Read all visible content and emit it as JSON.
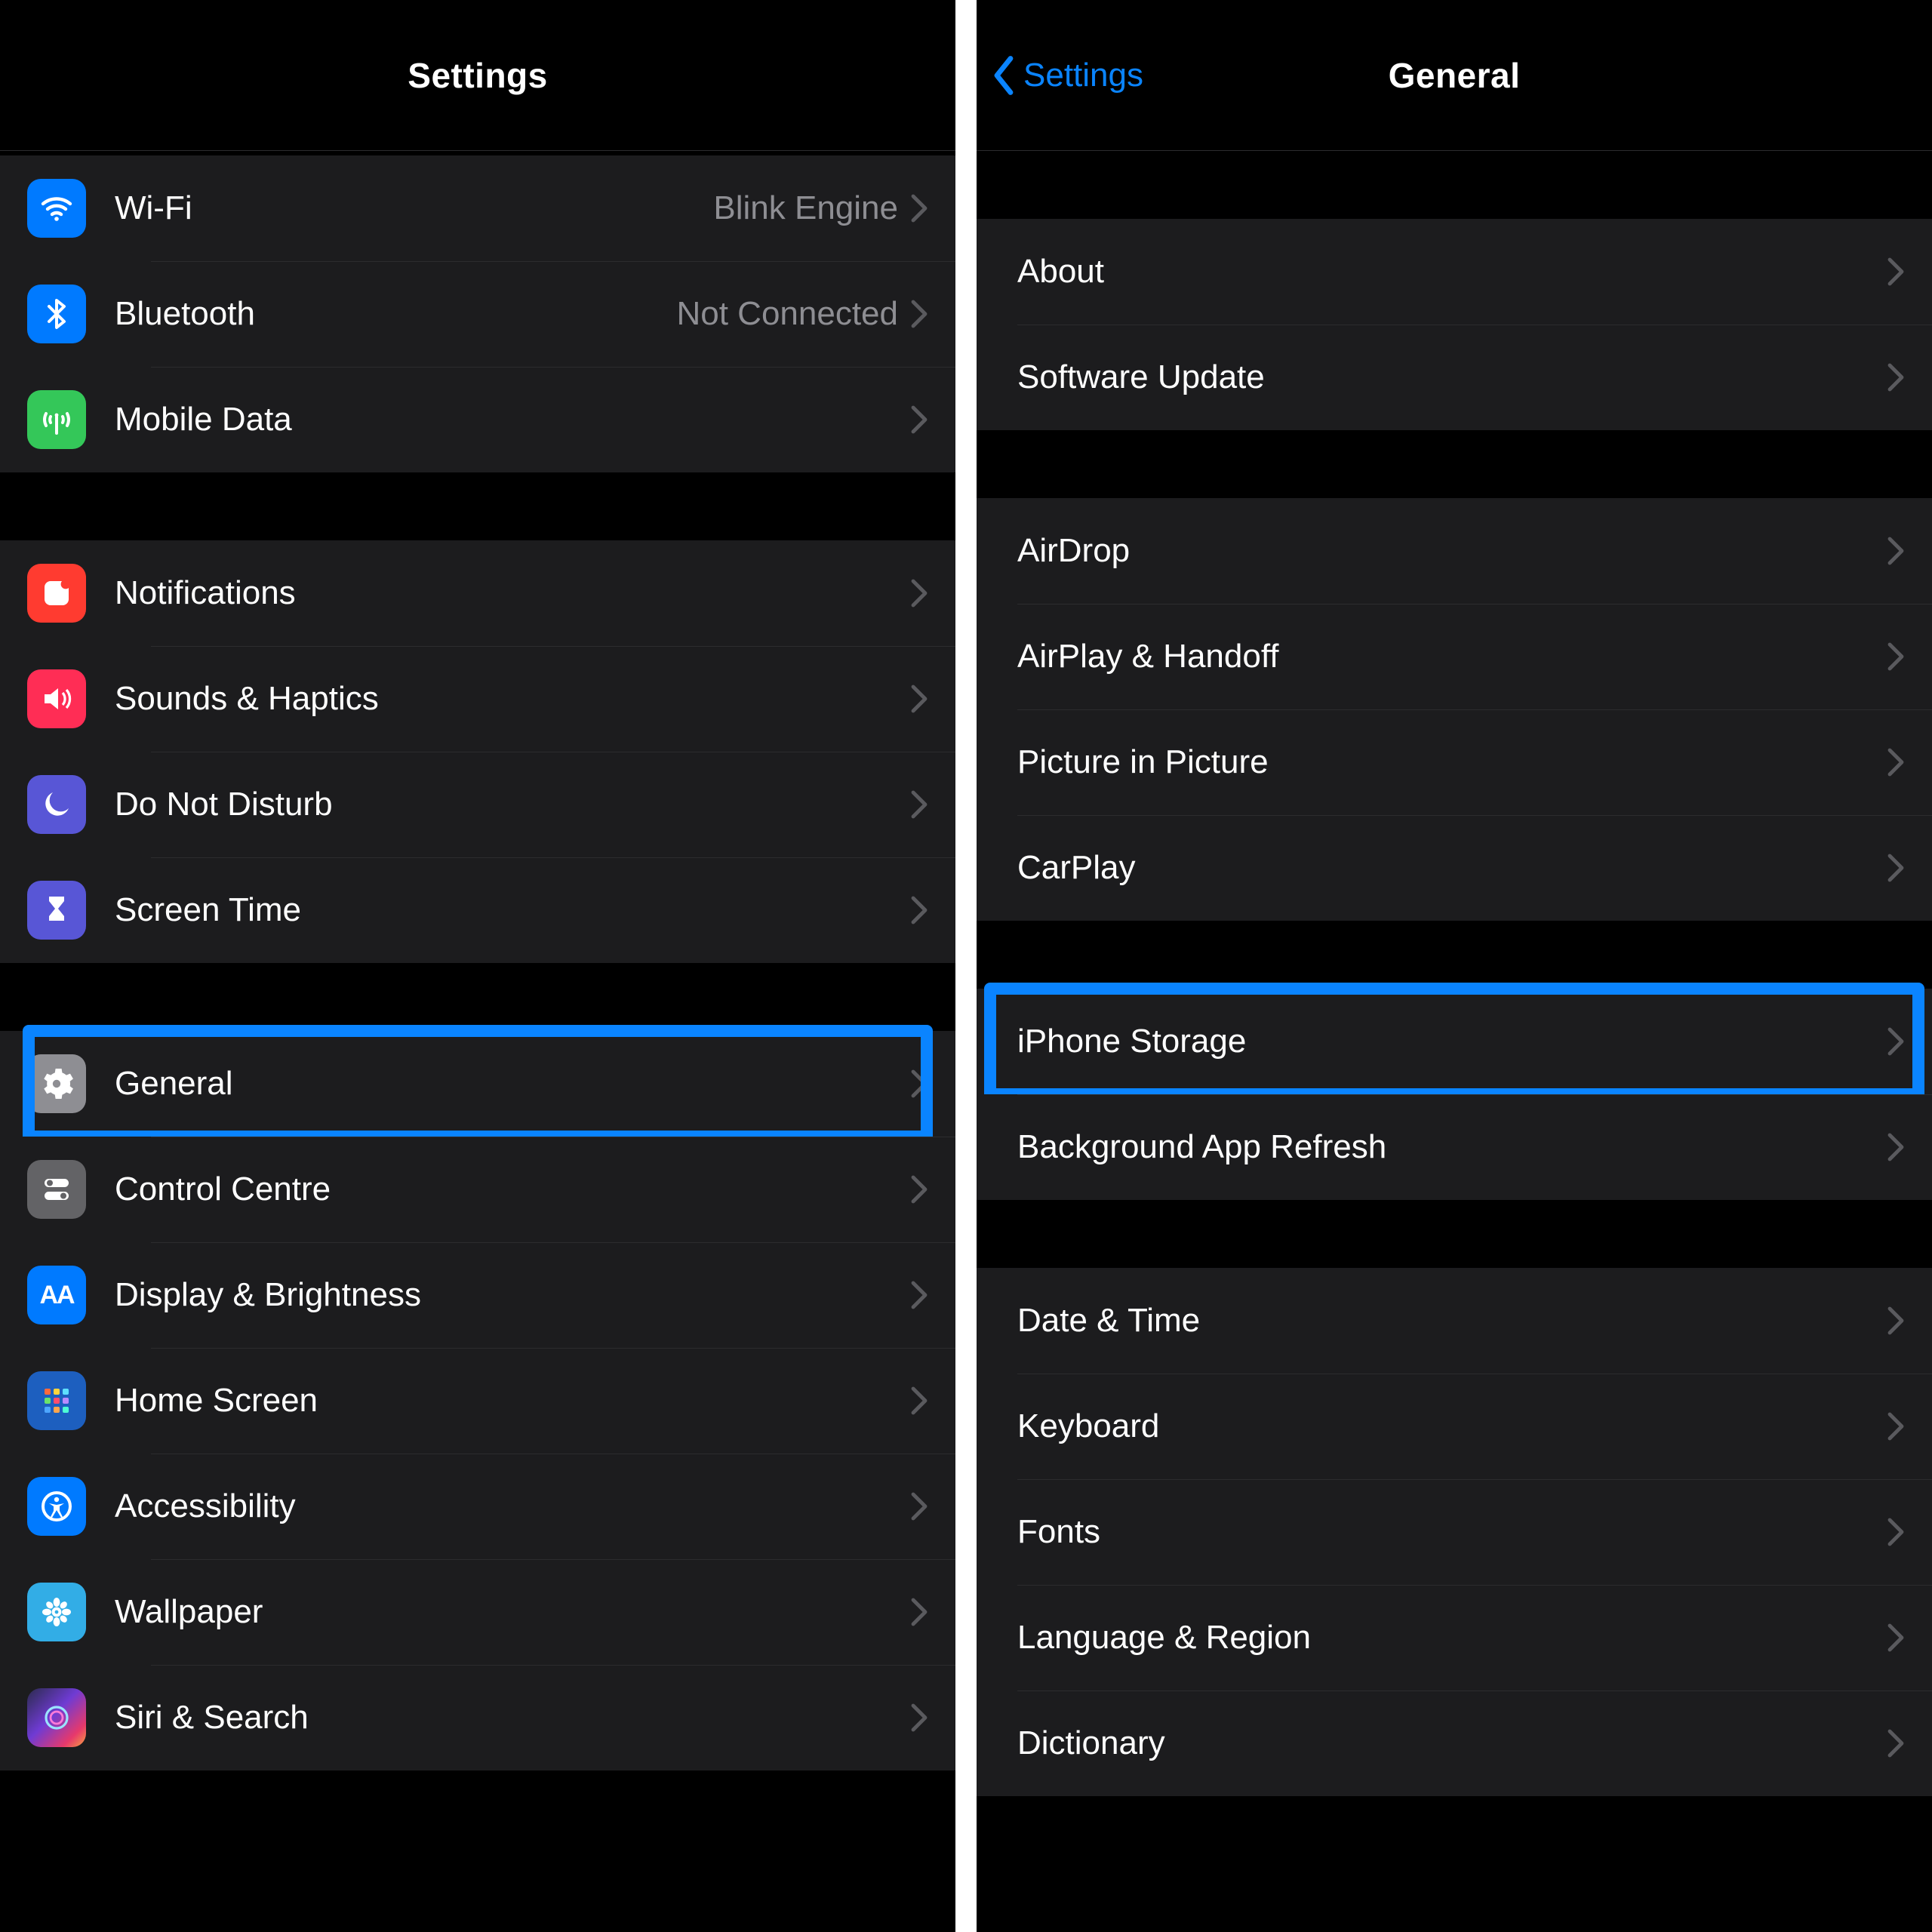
{
  "left": {
    "title": "Settings",
    "groups": [
      {
        "rows": [
          {
            "id": "wifi",
            "label": "Wi-Fi",
            "value": "Blink Engine",
            "icon": "wifi-icon",
            "icon_bg": "bg-blue"
          },
          {
            "id": "bluetooth",
            "label": "Bluetooth",
            "value": "Not Connected",
            "icon": "bluetooth-icon",
            "icon_bg": "bg-blue"
          },
          {
            "id": "mobile-data",
            "label": "Mobile Data",
            "value": "",
            "icon": "antenna-icon",
            "icon_bg": "bg-green"
          }
        ]
      },
      {
        "rows": [
          {
            "id": "notifications",
            "label": "Notifications",
            "value": "",
            "icon": "bell-square-icon",
            "icon_bg": "bg-red"
          },
          {
            "id": "sounds-haptics",
            "label": "Sounds & Haptics",
            "value": "",
            "icon": "speaker-icon",
            "icon_bg": "bg-pink"
          },
          {
            "id": "do-not-disturb",
            "label": "Do Not Disturb",
            "value": "",
            "icon": "moon-icon",
            "icon_bg": "bg-purple"
          },
          {
            "id": "screen-time",
            "label": "Screen Time",
            "value": "",
            "icon": "hourglass-icon",
            "icon_bg": "bg-purple"
          }
        ]
      },
      {
        "rows": [
          {
            "id": "general",
            "label": "General",
            "value": "",
            "icon": "gear-icon",
            "icon_bg": "bg-gray",
            "highlight": true
          },
          {
            "id": "control-centre",
            "label": "Control Centre",
            "value": "",
            "icon": "switches-icon",
            "icon_bg": "bg-gray2"
          },
          {
            "id": "display-brightness",
            "label": "Display & Brightness",
            "value": "",
            "icon": "aa-icon",
            "icon_bg": "bg-blue"
          },
          {
            "id": "home-screen",
            "label": "Home Screen",
            "value": "",
            "icon": "grid-icon",
            "icon_bg": "bg-darkblue"
          },
          {
            "id": "accessibility",
            "label": "Accessibility",
            "value": "",
            "icon": "accessibility-icon",
            "icon_bg": "bg-blue"
          },
          {
            "id": "wallpaper",
            "label": "Wallpaper",
            "value": "",
            "icon": "flower-icon",
            "icon_bg": "bg-cyan"
          },
          {
            "id": "siri-search",
            "label": "Siri & Search",
            "value": "",
            "icon": "siri-icon",
            "icon_bg": "bg-siri"
          }
        ]
      }
    ]
  },
  "right": {
    "title": "General",
    "back_label": "Settings",
    "groups": [
      {
        "rows": [
          {
            "id": "about",
            "label": "About"
          },
          {
            "id": "software-update",
            "label": "Software Update"
          }
        ]
      },
      {
        "rows": [
          {
            "id": "airdrop",
            "label": "AirDrop"
          },
          {
            "id": "airplay-handoff",
            "label": "AirPlay & Handoff"
          },
          {
            "id": "picture-in-picture",
            "label": "Picture in Picture"
          },
          {
            "id": "carplay",
            "label": "CarPlay"
          }
        ]
      },
      {
        "rows": [
          {
            "id": "iphone-storage",
            "label": "iPhone Storage",
            "highlight": true
          },
          {
            "id": "background-app-refresh",
            "label": "Background App Refresh"
          }
        ]
      },
      {
        "rows": [
          {
            "id": "date-time",
            "label": "Date & Time"
          },
          {
            "id": "keyboard",
            "label": "Keyboard"
          },
          {
            "id": "fonts",
            "label": "Fonts"
          },
          {
            "id": "language-region",
            "label": "Language & Region"
          },
          {
            "id": "dictionary",
            "label": "Dictionary"
          }
        ]
      }
    ]
  },
  "icons_text": {
    "aa-icon": "AA"
  }
}
